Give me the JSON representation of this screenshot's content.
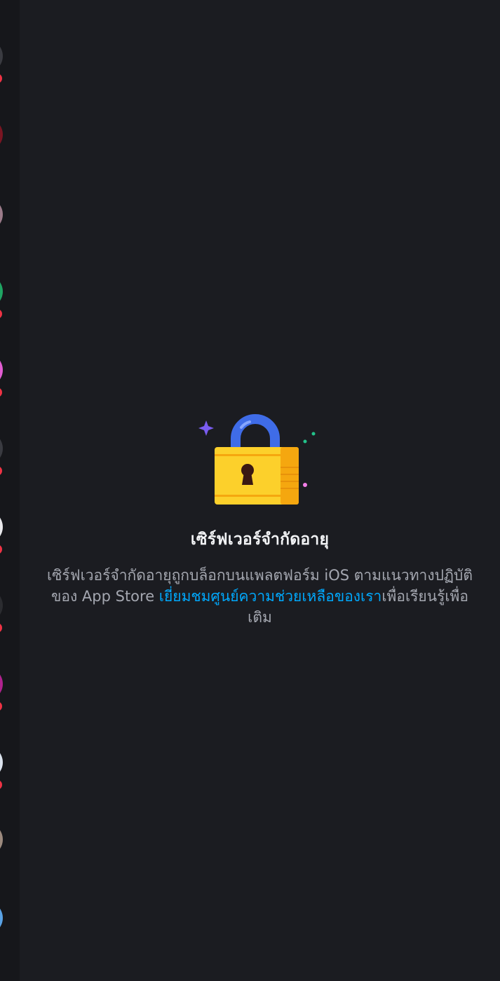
{
  "notice": {
    "icon": "padlock-icon",
    "title": "เซิร์ฟเวอร์จำกัดอายุ",
    "body_before": "เซิร์ฟเวอร์จำกัดอายุถูกบล็อกบนแพลตฟอร์ม iOS ตามแนวทางปฏิบัติของ App Store ",
    "link_text": "เยี่ยมชมศูนย์ความช่วยเหลือของเรา",
    "body_after": "เพื่อเรียนรู้เพื่อเติม"
  },
  "colors": {
    "background": "#1b1c21",
    "rail": "#16171b",
    "title": "#f2f3f5",
    "body": "#a4a7b0",
    "link": "#00a8fc",
    "badge": "#ef3345",
    "lock_body": "#fcd02b",
    "lock_shackle": "#3f6ce8"
  },
  "rail": {
    "servers": [
      {
        "name": "server-1",
        "color": "#3a3b41",
        "badge": true
      },
      {
        "name": "server-2",
        "color": "#7a1522",
        "badge": false
      },
      {
        "name": "server-3",
        "color": "#9b7b8a",
        "badge": false
      },
      {
        "name": "server-4",
        "color": "#1fa563",
        "badge": true
      },
      {
        "name": "server-5",
        "color": "#e25dd2",
        "badge": true
      },
      {
        "name": "server-6",
        "color": "#3a3b41",
        "badge": true
      },
      {
        "name": "server-7",
        "color": "#e9e9ec",
        "badge": true
      },
      {
        "name": "server-8",
        "color": "#2b2c30",
        "badge": true
      },
      {
        "name": "server-9",
        "color": "#b0228f",
        "badge": true
      },
      {
        "name": "server-10",
        "color": "#dbe3ee",
        "badge": true
      },
      {
        "name": "server-11",
        "color": "#9c8a7e",
        "badge": false
      },
      {
        "name": "server-12",
        "color": "#5aa3e6",
        "badge": false
      }
    ]
  }
}
